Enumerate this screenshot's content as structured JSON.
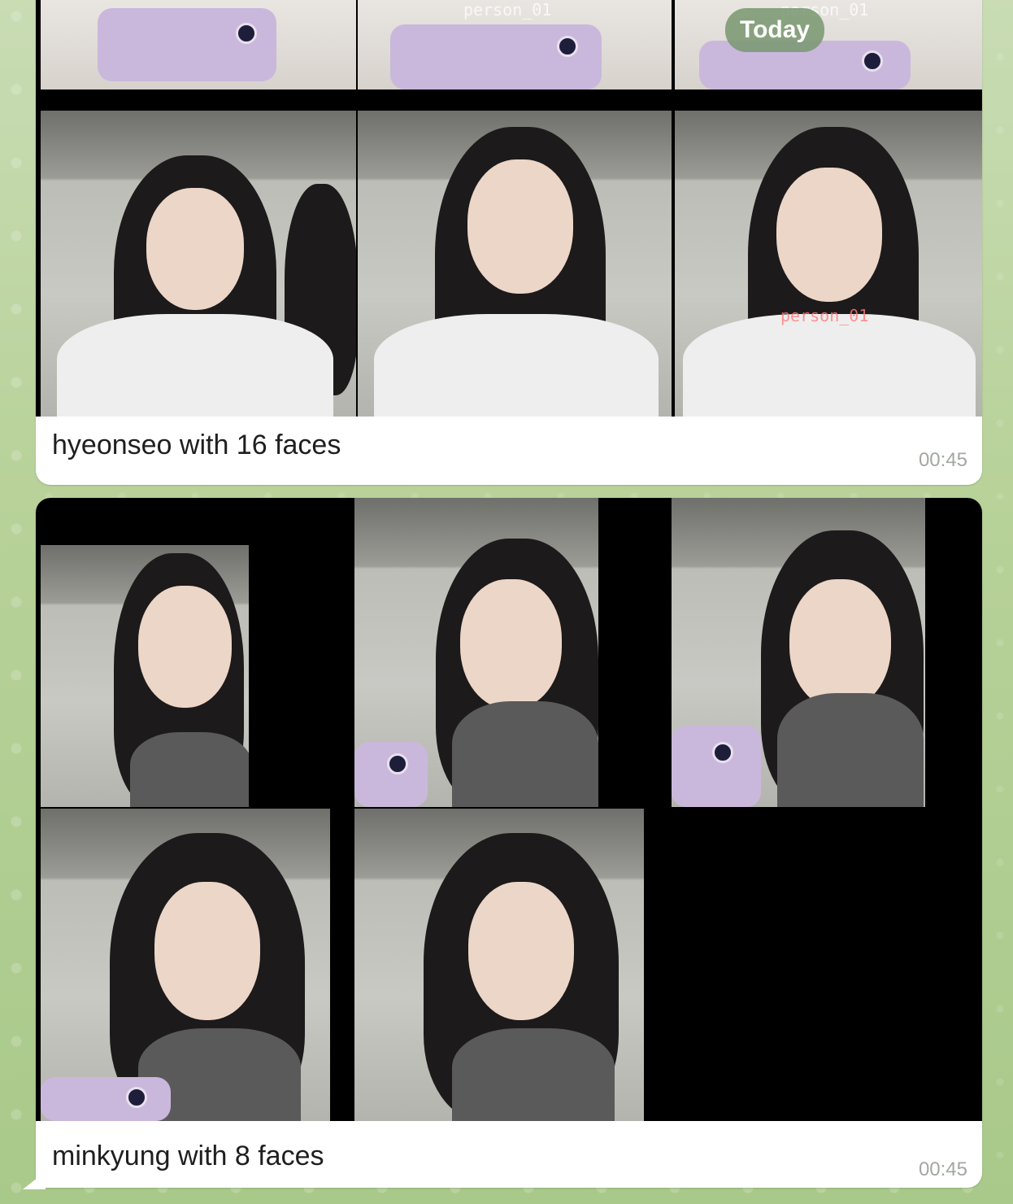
{
  "today_label": "Today",
  "overlay_texts": [
    "person_01",
    "person_01",
    "person_01"
  ],
  "messages": [
    {
      "caption": "hyeonseo with 16 faces",
      "time": "00:45"
    },
    {
      "caption": "minkyung with 8 faces",
      "time": "00:45"
    }
  ],
  "colors": {
    "bubble": "#ffffff",
    "time_text": "#a2a8a0",
    "wallpaper": "#b8d29a",
    "pill": "#7a966e"
  }
}
